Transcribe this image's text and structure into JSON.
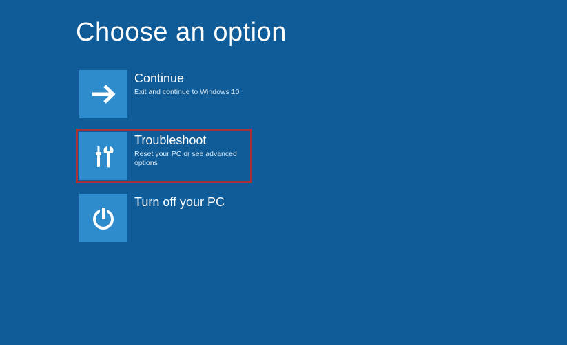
{
  "page": {
    "title": "Choose an option"
  },
  "options": [
    {
      "title": "Continue",
      "subtitle": "Exit and continue to Windows 10",
      "highlighted": false
    },
    {
      "title": "Troubleshoot",
      "subtitle": "Reset your PC or see advanced options",
      "highlighted": true
    },
    {
      "title": "Turn off your PC",
      "subtitle": "",
      "highlighted": false
    }
  ],
  "colors": {
    "background": "#0f5c99",
    "tile_icon_bg": "#2f8ccc",
    "highlight_border": "#a83238"
  }
}
